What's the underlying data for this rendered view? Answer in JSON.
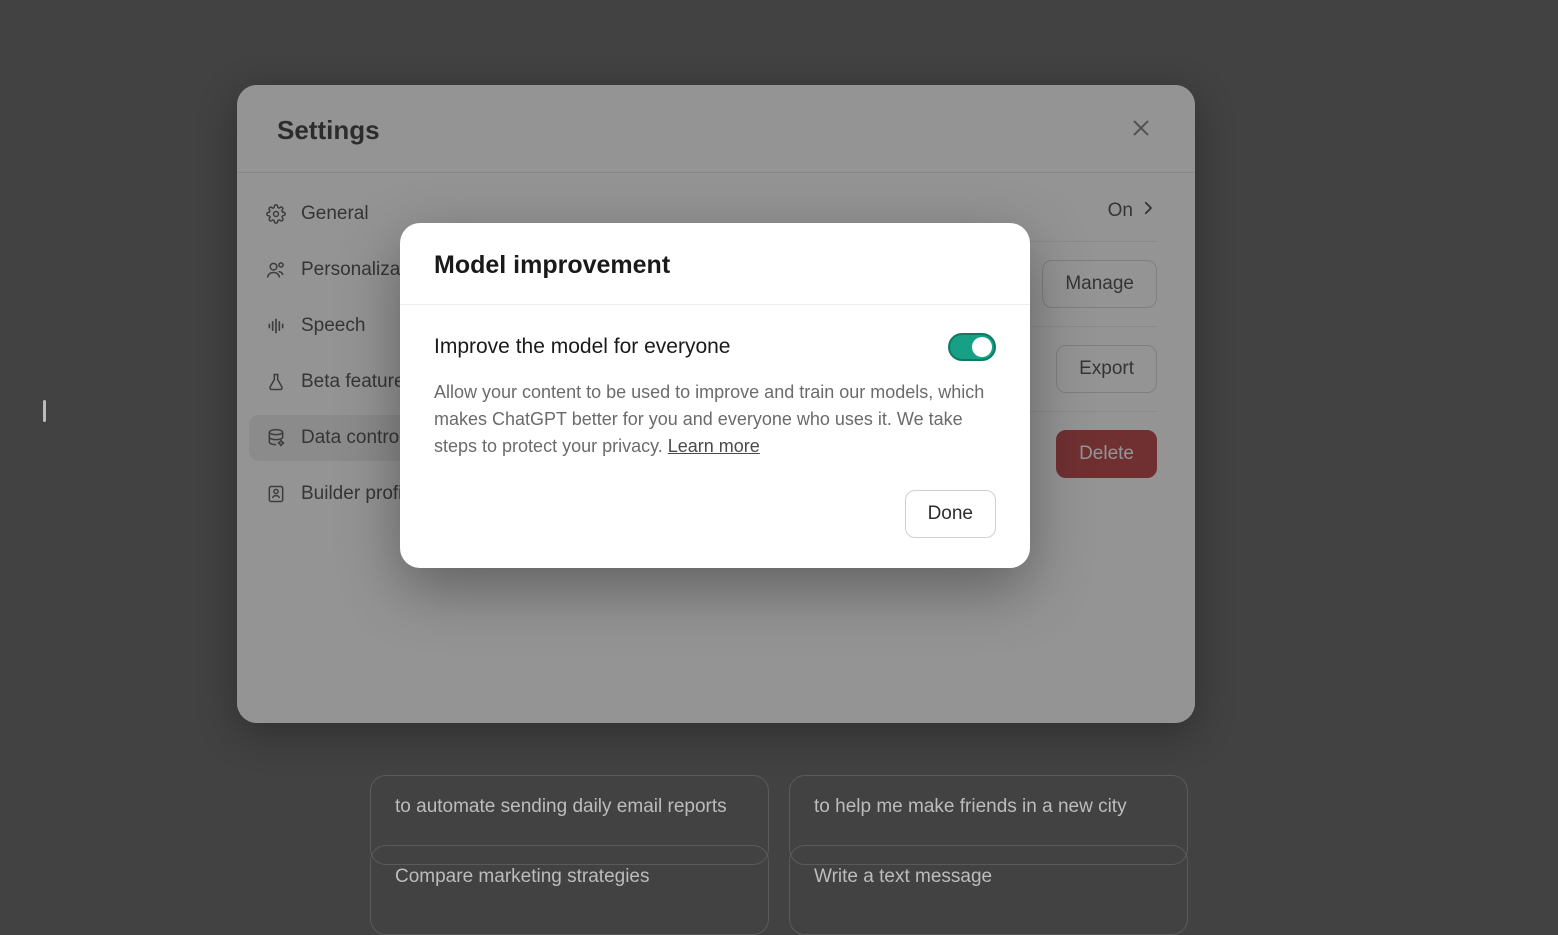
{
  "background": {
    "cards": [
      "to automate sending daily email reports",
      "to help me make friends in a new city",
      "Compare marketing strategies",
      "Write a text message"
    ]
  },
  "settings": {
    "title": "Settings",
    "nav": [
      {
        "label": "General"
      },
      {
        "label": "Personalization"
      },
      {
        "label": "Speech"
      },
      {
        "label": "Beta features"
      },
      {
        "label": "Data controls"
      },
      {
        "label": "Builder profile"
      }
    ],
    "content": {
      "row0_status": "On",
      "manage_label": "Manage",
      "export_label": "Export",
      "delete_label": "Delete"
    }
  },
  "dialog": {
    "title": "Model improvement",
    "toggle_label": "Improve the model for everyone",
    "description": "Allow your content to be used to improve and train our models, which makes ChatGPT better for you and everyone who uses it. We take steps to protect your privacy. ",
    "learn_more": "Learn more",
    "done_label": "Done"
  }
}
